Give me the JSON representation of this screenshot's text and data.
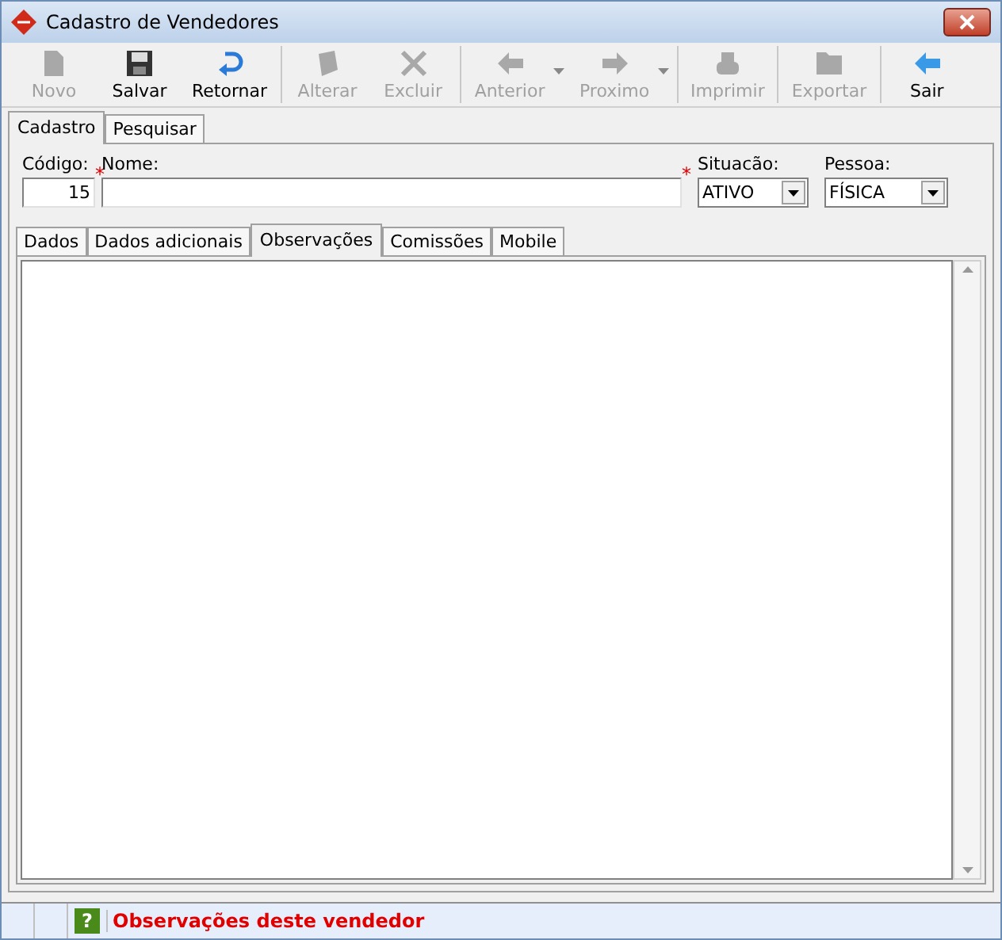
{
  "window": {
    "title": "Cadastro de Vendedores"
  },
  "toolbar": {
    "groups": [
      [
        {
          "label": "Novo",
          "kind": "new",
          "disabled": true,
          "dropdown": false
        },
        {
          "label": "Salvar",
          "kind": "save",
          "disabled": false,
          "dropdown": false
        },
        {
          "label": "Retornar",
          "kind": "undo",
          "disabled": false,
          "dropdown": false
        }
      ],
      [
        {
          "label": "Alterar",
          "kind": "edit",
          "disabled": true,
          "dropdown": false
        },
        {
          "label": "Excluir",
          "kind": "delete",
          "disabled": true,
          "dropdown": false
        }
      ],
      [
        {
          "label": "Anterior",
          "kind": "prev",
          "disabled": true,
          "dropdown": true
        },
        {
          "label": "Proximo",
          "kind": "next",
          "disabled": true,
          "dropdown": true
        }
      ],
      [
        {
          "label": "Imprimir",
          "kind": "print",
          "disabled": true,
          "dropdown": false
        }
      ],
      [
        {
          "label": "Exportar",
          "kind": "export",
          "disabled": true,
          "dropdown": false
        }
      ],
      [
        {
          "label": "Sair",
          "kind": "exit",
          "disabled": false,
          "dropdown": false
        }
      ]
    ]
  },
  "main_tabs": [
    {
      "label": "Cadastro",
      "selected": true
    },
    {
      "label": "Pesquisar",
      "selected": false
    }
  ],
  "form": {
    "codigo": {
      "label": "Código:",
      "value": "15"
    },
    "nome": {
      "label": "Nome:"
    },
    "required_mark": "*",
    "situacao": {
      "label": "Situacão:",
      "value": "ATIVO"
    },
    "pessoa": {
      "label": "Pessoa:",
      "value": "FÍSICA"
    }
  },
  "sub_tabs": [
    {
      "label": "Dados",
      "selected": false
    },
    {
      "label": "Dados adicionais",
      "selected": false
    },
    {
      "label": "Observações",
      "selected": true
    },
    {
      "label": "Comissões",
      "selected": false
    },
    {
      "label": "Mobile",
      "selected": false
    }
  ],
  "status_bar": {
    "help_icon": "?",
    "message": "Observações deste vendedor"
  }
}
